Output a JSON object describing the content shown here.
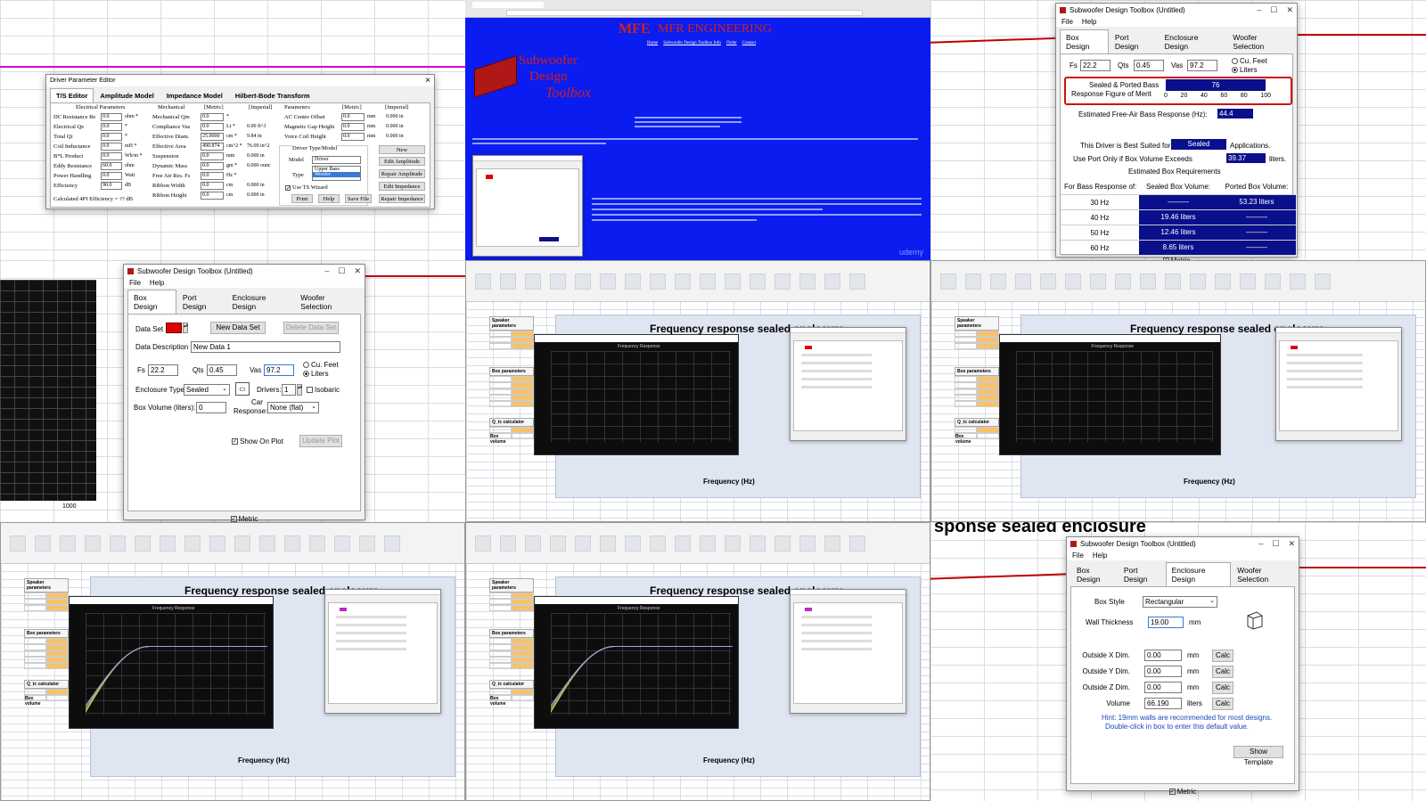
{
  "dpe": {
    "title": "Driver Parameter Editor",
    "close": "×",
    "tabs": [
      "T/S Editor",
      "Amplitude Model",
      "Impedance Model",
      "Hilbert-Bode Transform"
    ],
    "col_heads": [
      "Electrical Parameters",
      "Mechanical",
      "[Metric]",
      "[Imperial]",
      "Parameters",
      "[Metric]",
      "[Imperial]"
    ],
    "elec": [
      {
        "l": "DC Resistance Re",
        "v": "0.0",
        "u": "ohm *"
      },
      {
        "l": "Electrical Qe",
        "v": "0.0",
        "u": "*"
      },
      {
        "l": "Total Qt",
        "v": "0.0",
        "u": "*"
      },
      {
        "l": "Coil Inductance",
        "v": "0.0",
        "u": "mH *"
      },
      {
        "l": "B*L Product",
        "v": "0.0",
        "u": "Wb/m *"
      },
      {
        "l": "Eddy Resistance",
        "v": "60.0",
        "u": "ohm"
      },
      {
        "l": "Power Handling",
        "v": "0.0",
        "u": "Watt"
      },
      {
        "l": "Efficiency",
        "v": "90.0",
        "u": "dB"
      }
    ],
    "calc_eff": "Calculated 4PI Efficiency = ?? dB",
    "mech": [
      {
        "l": "Mechanical Qm",
        "v": "0.0",
        "u": "*",
        "i": ""
      },
      {
        "l": "Compliance Vas",
        "v": "0.0",
        "u": "Lt *",
        "i": "0.00 ft^3"
      },
      {
        "l": "Effective Diam.",
        "v": "25.0000",
        "u": "cm *",
        "i": "9.84 in"
      },
      {
        "l": "Effective Area",
        "v": "490.874",
        "u": "cm^2 *",
        "i": "76.09 in^2"
      },
      {
        "l": "Suspension",
        "v": "0.0",
        "u": "mm",
        "i": "0.000 in"
      },
      {
        "l": "Dynamic Mass",
        "v": "0.0",
        "u": "gm *",
        "i": "0.000 ounc"
      },
      {
        "l": "Free Air Res. Fs",
        "v": "0.0",
        "u": "Hz *",
        "i": ""
      },
      {
        "l": "Ribbon Width",
        "v": "0.0",
        "u": "cm",
        "i": "0.000 in"
      },
      {
        "l": "Ribbon Height",
        "v": "0.0",
        "u": "cm",
        "i": "0.000 in"
      }
    ],
    "params": [
      {
        "l": "AC Centre Offset",
        "v": "0.0",
        "u": "mm",
        "i": "0.000 in"
      },
      {
        "l": "Magnetic Gap Height",
        "v": "0.0",
        "u": "mm",
        "i": "0.000 in"
      },
      {
        "l": "Voice Coil Height",
        "v": "0.0",
        "u": "mm",
        "i": "0.000 in"
      }
    ],
    "driver_type_model": "Driver Type/Model",
    "model_label": "Model",
    "model_value": "Driver",
    "type_label": "Type",
    "type_options": [
      "Upper Bass",
      "Woofer"
    ],
    "use_ts": "Use TS Wizard",
    "btn_new": "New",
    "btn_edit_amp": "Edit Amplitude",
    "btn_repair_amp": "Repair Amplitude",
    "btn_edit_imp": "Edit Impedance",
    "btn_repair_imp": "Repair Impedance",
    "btn_print": "Print",
    "btn_help": "Help",
    "btn_save": "Save File"
  },
  "web": {
    "logo_prefix": "MFE",
    "company": "MFR ENGINEERING",
    "nav": [
      "Home",
      "Subwoofer Design Toolbox Info",
      "Order",
      "Contact"
    ],
    "brand_line1": "Subwoofer",
    "brand_line2": "Design",
    "brand_line3": "Toolbox",
    "watermark": "udemy"
  },
  "app": {
    "title": "Subwoofer Design Toolbox (Untitled)",
    "menu": [
      "File",
      "Help"
    ],
    "tabs": [
      "Box Design",
      "Port Design",
      "Enclosure Design",
      "Woofer Selection"
    ],
    "metric": "Metric"
  },
  "merit": {
    "fs_label": "Fs",
    "fs": "22.2",
    "qts_label": "Qts",
    "qts": "0.45",
    "vas_label": "Vas",
    "vas": "97.2",
    "cu_feet": "Cu. Feet",
    "liters": "Liters",
    "fom_label1": "Sealed & Ported Bass",
    "fom_label2": "Response Figure of Merit",
    "fom_value": "76",
    "scale": [
      "0",
      "20",
      "40",
      "60",
      "80",
      "100"
    ],
    "est_label": "Estimated Free-Air Bass Response (Hz):",
    "est_value": "44.4",
    "best_label": "This Driver is Best Suited for",
    "best_value": "Sealed",
    "best_suffix": "Applications.",
    "port_label": "Use Port Only if Box Volume Exceeds",
    "port_value": "39.37",
    "port_suffix": "liters.",
    "req_title": "Estimated Box Requirements",
    "table_heads": [
      "For Bass Response of:",
      "Sealed Box Volume:",
      "Ported Box Volume:"
    ],
    "rows": [
      {
        "hz": "30 Hz",
        "sealed": "———",
        "ported": "53.23 liters"
      },
      {
        "hz": "40 Hz",
        "sealed": "19.46 liters",
        "ported": "———"
      },
      {
        "hz": "50 Hz",
        "sealed": "12.46 liters",
        "ported": "———"
      },
      {
        "hz": "60 Hz",
        "sealed": "8.65 liters",
        "ported": "———"
      }
    ]
  },
  "box": {
    "dataset_label": "Data Set",
    "btn_new": "New Data Set",
    "btn_delete": "Delete Data Set",
    "desc_label": "Data Description",
    "desc_value": "New Data 1",
    "fs_label": "Fs",
    "fs": "22.2",
    "qts_label": "Qts",
    "qts": "0.45",
    "vas_label": "Vas",
    "vas": "97.2",
    "cu_feet": "Cu. Feet",
    "liters": "Liters",
    "enc_label": "Enclosure Type:",
    "enc_value": "Sealed",
    "drivers_label": "Drivers:",
    "drivers_value": "1",
    "isobaric": "Isobaric",
    "vol_label": "Box Volume (liters):",
    "vol_value": "0",
    "car_label1": "Car",
    "car_label2": "Response:",
    "car_value": "None (flat)",
    "show_on_plot": "Show On Plot",
    "btn_update": "Update Plot",
    "axis_label": "1000"
  },
  "enclosure": {
    "style_label": "Box Style",
    "style_value": "Rectangular",
    "wall_label": "Wall Thickness",
    "wall_value": "19.00",
    "wall_unit": "mm",
    "x_label": "Outside X Dim.",
    "x_value": "0.00",
    "y_label": "Outside Y Dim.",
    "y_value": "0.00",
    "z_label": "Outside Z Dim.",
    "z_value": "0.00",
    "dim_unit": "mm",
    "vol_label": "Volume",
    "vol_value": "66.190",
    "vol_unit": "liters",
    "calc": "Calc",
    "hint1": "Hint: 19mm walls are recommended for most designs.",
    "hint2": "Double-click in box to enter this default value.",
    "btn_template": "Show Template",
    "bg_title": "sponse sealed enclosure"
  },
  "excel": {
    "chart_title": "Frequency response sealed enclosure",
    "xlabel": "Frequency (Hz)",
    "speaker_params": "Speaker parameters",
    "box_params": "Box parameters",
    "qtc_calc": "Q_tc calculator",
    "box_volume": "Box volume",
    "plot_title": "Frequency Response"
  },
  "colors": {
    "web_bg": "#0b1cf0",
    "navy": "#0a0f8c",
    "red_dataset": "#e00000",
    "magenta_dataset": "#c02ac0",
    "pink_line": "#d400d4",
    "red_curve": "#c00000"
  }
}
